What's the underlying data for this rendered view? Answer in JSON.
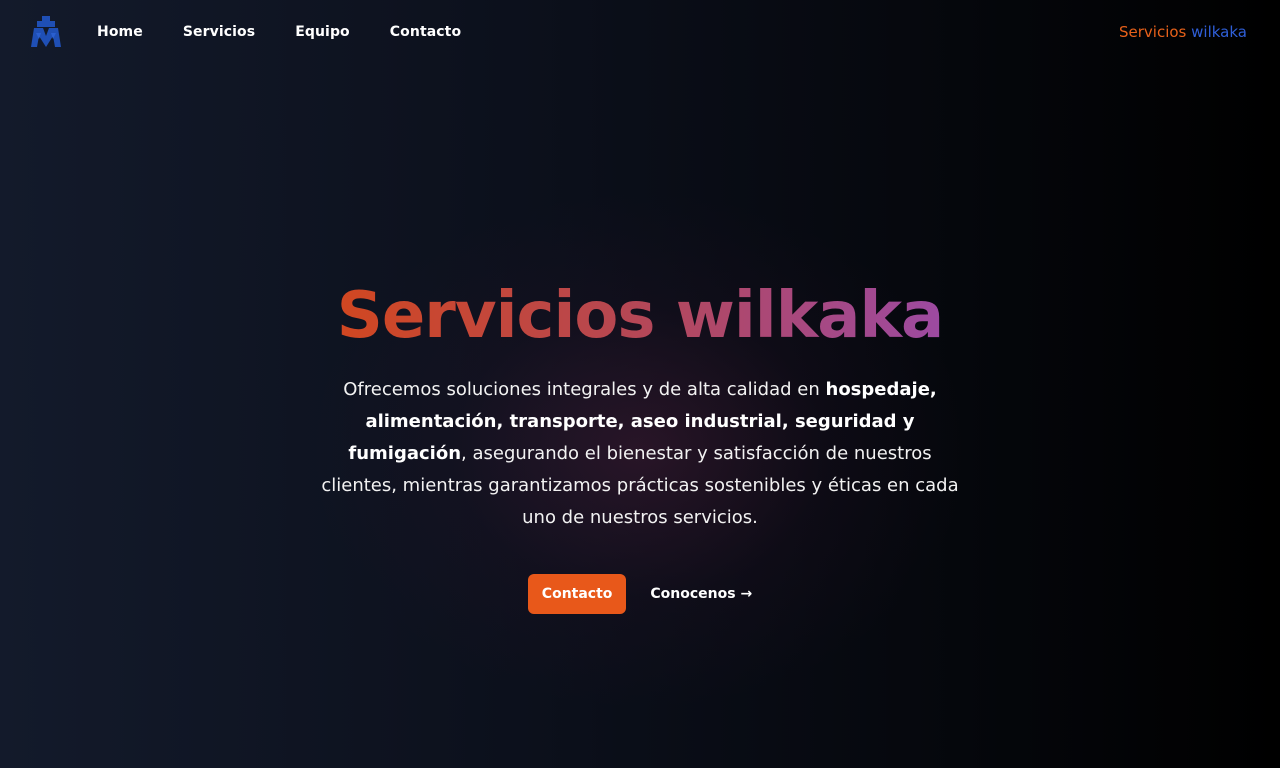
{
  "header": {
    "logo_icon": "wilkaka-logo-icon",
    "nav": [
      {
        "label": "Home"
      },
      {
        "label": "Servicios"
      },
      {
        "label": "Equipo"
      },
      {
        "label": "Contacto"
      }
    ],
    "brand_part1": "Servicios",
    "brand_part2": "wilkaka"
  },
  "hero": {
    "title": "Servicios wilkaka",
    "desc_intro": "Ofrecemos soluciones integrales y de alta calidad en ",
    "desc_bold": "hospedaje, alimentación, transporte, aseo industrial, seguridad y fumigación",
    "desc_rest": ", asegurando el bienestar y satisfacción de nuestros clientes, mientras garantizamos prácticas sostenibles y éticas en cada uno de nuestros servicios.",
    "primary_button": "Contacto",
    "secondary_link": "Conocenos →"
  },
  "colors": {
    "accent_orange": "#e8581a",
    "brand_blue": "#2f5fd8",
    "title_gradient_start": "#d4471c",
    "title_gradient_end": "#9a4aa8",
    "background_dark": "#0b0f1a"
  }
}
